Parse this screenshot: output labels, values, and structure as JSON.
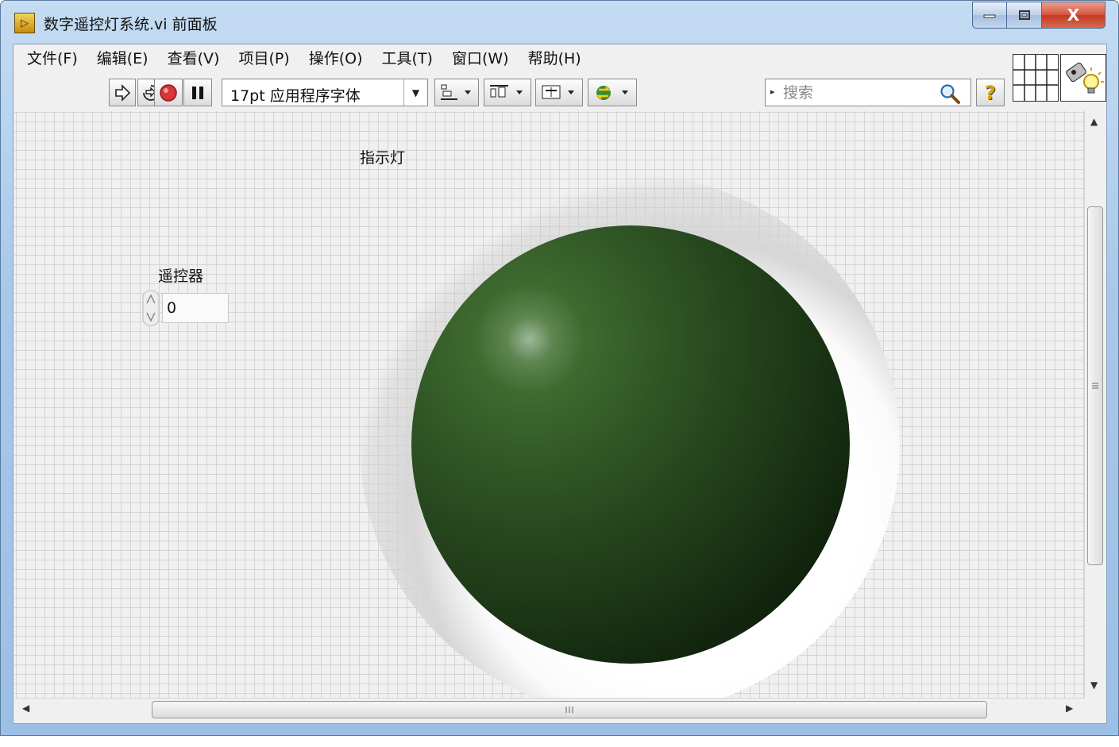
{
  "window": {
    "title": "数字遥控灯系统.vi 前面板",
    "controls": {
      "minimize": "–",
      "maximize": "▭",
      "close": "X"
    }
  },
  "menu": [
    "文件(F)",
    "编辑(E)",
    "查看(V)",
    "项目(P)",
    "操作(O)",
    "工具(T)",
    "窗口(W)",
    "帮助(H)"
  ],
  "toolbar": {
    "font": "17pt 应用程序字体",
    "search_placeholder": "搜索",
    "help_label": "?"
  },
  "panel": {
    "indicator_label": "指示灯",
    "indicator_state": "off",
    "indicator_color": "#2f5525",
    "control_label": "遥控器",
    "control_value": "0"
  }
}
